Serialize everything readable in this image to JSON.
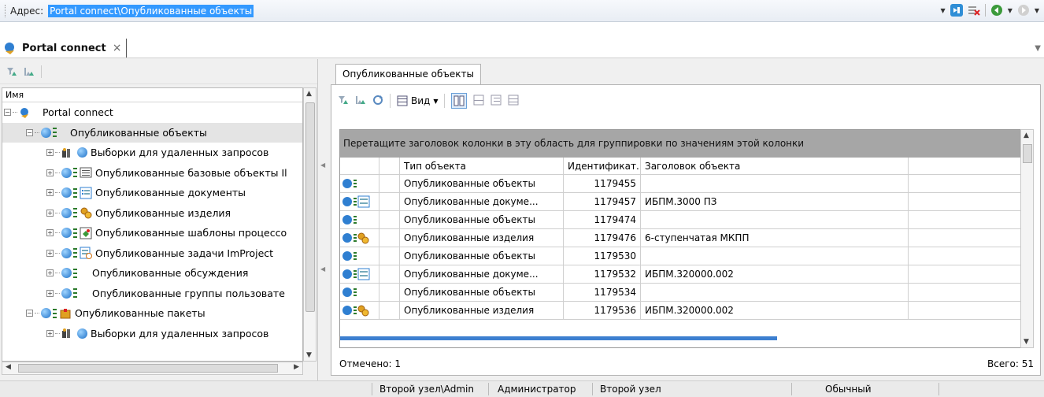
{
  "address": {
    "label": "Адрес:",
    "value": "Portal connect\\Опубликованные объекты"
  },
  "doc_tab": {
    "title": "Portal connect",
    "close": "×"
  },
  "tree": {
    "column_header": "Имя",
    "items": [
      {
        "label": "Portal connect",
        "level": 0,
        "icon": "app-node-icon"
      },
      {
        "label": "Опубликованные объекты",
        "level": 1,
        "icon": "published-node-icon"
      },
      {
        "label": "Выборки для удаленных запросов",
        "level": 2,
        "icon": "remote-query-icon"
      },
      {
        "label": "Опубликованные базовые объекты Il",
        "level": 2,
        "icon": "base-objects-icon"
      },
      {
        "label": "Опубликованные документы",
        "level": 2,
        "icon": "documents-icon"
      },
      {
        "label": "Опубликованные изделия",
        "level": 2,
        "icon": "products-icon"
      },
      {
        "label": "Опубликованные шаблоны процессо",
        "level": 2,
        "icon": "process-templates-icon"
      },
      {
        "label": "Опубликованные задачи ImProject",
        "level": 2,
        "icon": "tasks-icon"
      },
      {
        "label": "Опубликованные обсуждения",
        "level": 2,
        "icon": "discussions-icon"
      },
      {
        "label": "Опубликованные группы пользовате",
        "level": 2,
        "icon": "user-groups-icon"
      },
      {
        "label": "Опубликованные пакеты",
        "level": 1,
        "icon": "packages-icon"
      },
      {
        "label": "Выборки для удаленных запросов",
        "level": 2,
        "icon": "remote-query-icon"
      }
    ]
  },
  "right": {
    "tab": "Опубликованные объекты",
    "view_label": "Вид",
    "group_hint": "Перетащите заголовок колонки в эту область для группировки по значениям этой колонки",
    "columns": [
      "Тип объекта",
      "Идентификат...",
      "Заголовок объекта"
    ],
    "rows": [
      {
        "icon": "published-object-icon",
        "type": "Опубликованные объекты",
        "id": "1179455",
        "title": ""
      },
      {
        "icon": "published-document-icon",
        "type": "Опубликованные докуме...",
        "id": "1179457",
        "title": "ИБПМ.3000 ПЗ"
      },
      {
        "icon": "published-object-icon",
        "type": "Опубликованные объекты",
        "id": "1179474",
        "title": ""
      },
      {
        "icon": "published-product-icon",
        "type": "Опубликованные изделия",
        "id": "1179476",
        "title": "6-ступенчатая МКПП"
      },
      {
        "icon": "published-object-icon",
        "type": "Опубликованные объекты",
        "id": "1179530",
        "title": ""
      },
      {
        "icon": "published-document-icon",
        "type": "Опубликованные докуме...",
        "id": "1179532",
        "title": "ИБПМ.320000.002"
      },
      {
        "icon": "published-object-icon",
        "type": "Опубликованные объекты",
        "id": "1179534",
        "title": ""
      },
      {
        "icon": "published-product-icon",
        "type": "Опубликованные изделия",
        "id": "1179536",
        "title": "ИБПМ.320000.002"
      }
    ],
    "marked": "Отмечено: 1",
    "total": "Всего: 51"
  },
  "status": {
    "user": "Второй узел\\Admin",
    "role": "Администратор",
    "node": "Второй узел",
    "mode": "Обычный"
  },
  "colors": {
    "selection": "#3399ff",
    "group_band": "#a6a6a6",
    "accent_green": "#2b7a2b"
  }
}
